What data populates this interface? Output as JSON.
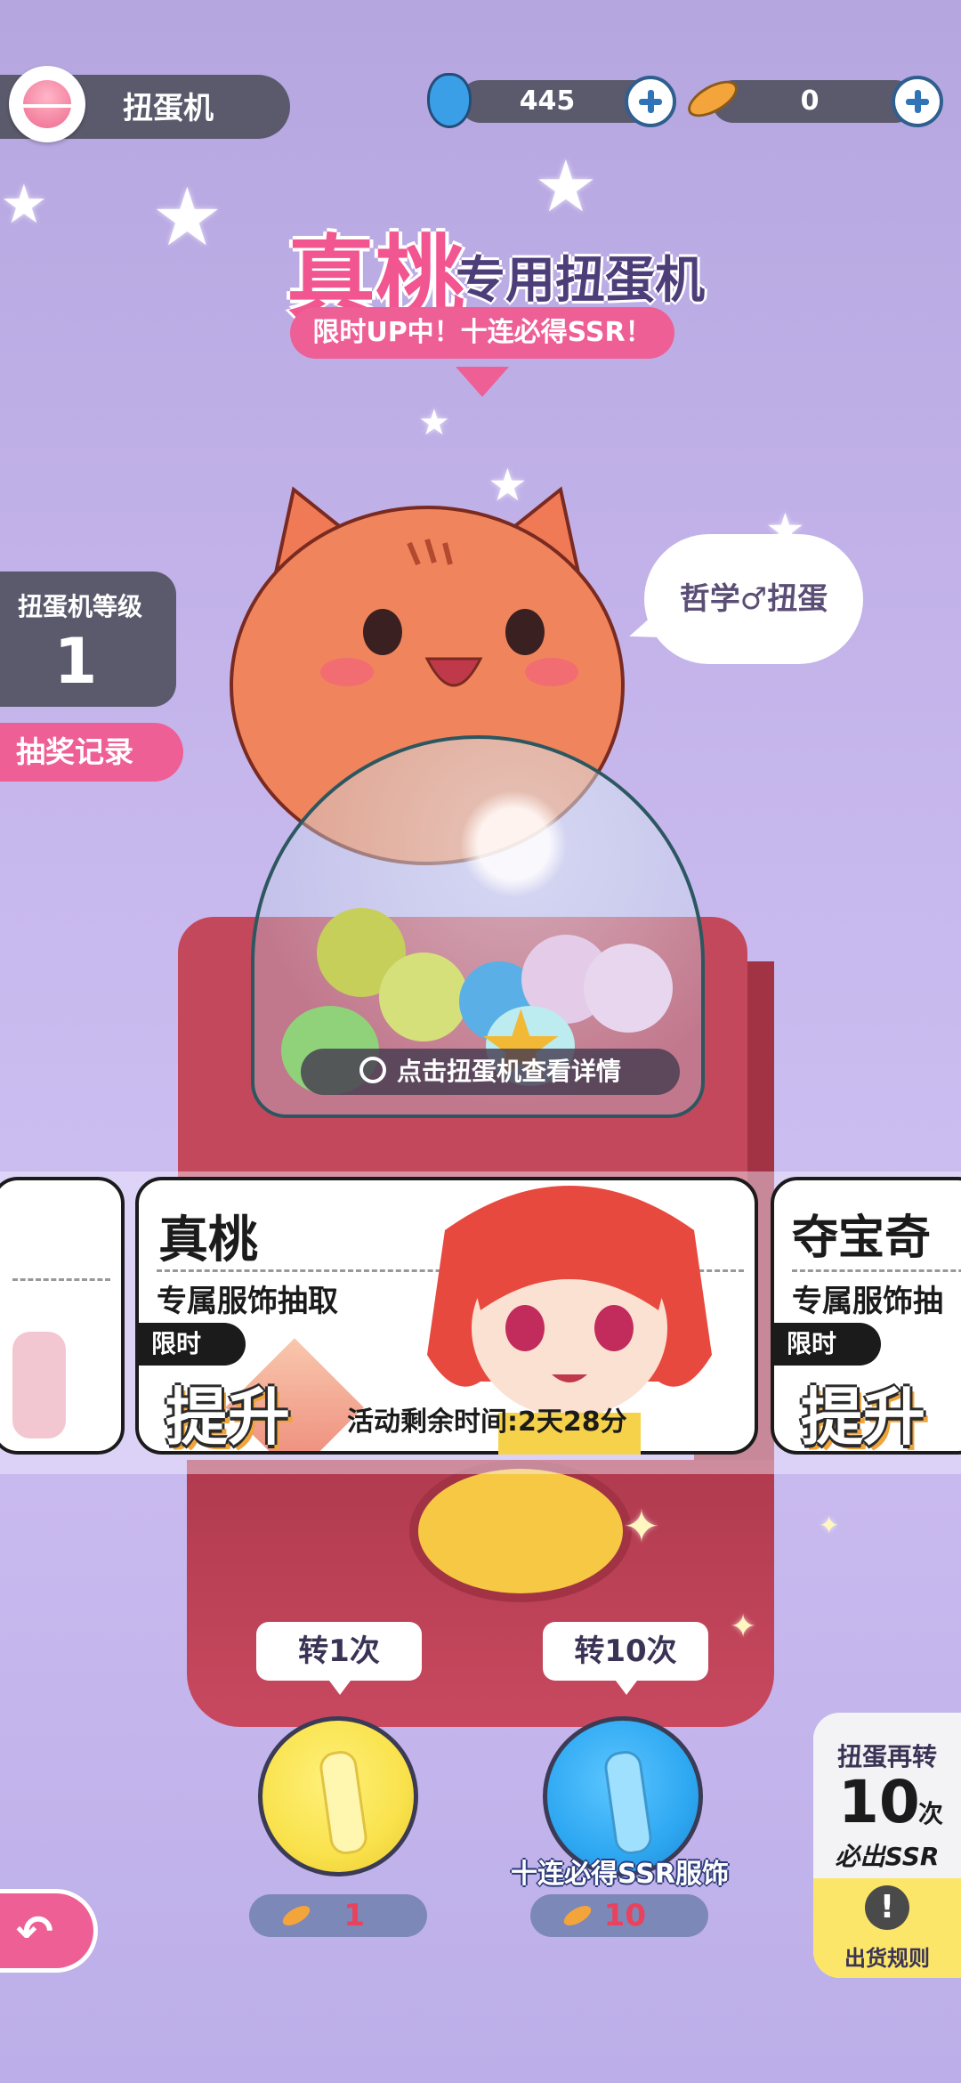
{
  "header": {
    "title": "扭蛋机",
    "currencies": [
      {
        "icon": "blue-gem-icon",
        "value": "445"
      },
      {
        "icon": "golden-fish-icon",
        "value": "0"
      }
    ]
  },
  "banner": {
    "title_name": "真桃",
    "title_suffix": "专用扭蛋机",
    "promo": "限时UP中！十连必得SSR！"
  },
  "level": {
    "label": "扭蛋机等级",
    "value": "1"
  },
  "records_button": "抽奖记录",
  "speech_bubble": "哲学♂扭蛋",
  "detail_hint": "点击扭蛋机查看详情",
  "cards": [
    {
      "name": "真桃",
      "subtitle": "专属服饰抽取",
      "tag": "限时",
      "boost": "提升",
      "timer": "活动剩余时间:2天28分"
    },
    {
      "name": "夺宝奇",
      "subtitle": "专属服饰抽",
      "tag": "限时",
      "boost": "提升"
    }
  ],
  "spin": {
    "single_label": "转1次",
    "single_cost": "1",
    "ten_label": "转10次",
    "ten_cost": "10",
    "ten_note": "十连必得SSR服饰"
  },
  "guarantee": {
    "line1": "扭蛋再转",
    "count": "10",
    "unit": "次",
    "line3": "必出SSR",
    "rules_label": "出货规则"
  },
  "colors": {
    "accent_pink": "#ee5f96",
    "panel_dark": "#5b5a6d",
    "coin_yellow": "#f9e24c",
    "coin_blue": "#2ea8f2"
  }
}
